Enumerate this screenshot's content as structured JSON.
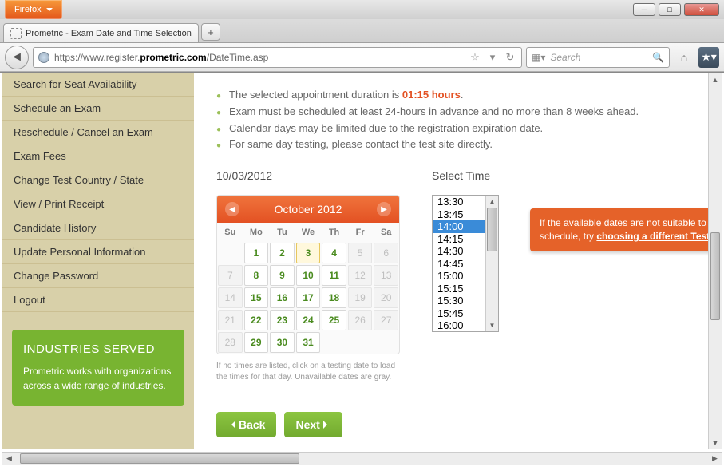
{
  "browser": {
    "name": "Firefox",
    "tab_title": "Prometric - Exam Date and Time Selection",
    "url_pre": "https://www.register.",
    "url_domain": "prometric.com",
    "url_post": "/DateTime.asp",
    "search_placeholder": "Search"
  },
  "sidebar": {
    "links": [
      "Search for Seat Availability",
      "Schedule an Exam",
      "Reschedule / Cancel an Exam",
      "Exam Fees",
      "Change Test Country / State",
      "View / Print Receipt",
      "Candidate History",
      "Update Personal Information",
      "Change Password",
      "Logout"
    ],
    "card_title": "Industries Served",
    "card_body": "Prometric works with organizations across a wide range of industries."
  },
  "bullets": {
    "b1_pre": "The selected appointment duration is ",
    "b1_hl": "01:15 hours",
    "b1_post": ".",
    "b2": "Exam must be scheduled at least 24-hours in advance and no more than 8 weeks ahead.",
    "b3": "Calendar days may be limited due to the registration expiration date.",
    "b4": "For same day testing, please contact the test site directly."
  },
  "date": {
    "selected": "10/03/2012",
    "month_label": "October 2012",
    "dow": [
      "Su",
      "Mo",
      "Tu",
      "We",
      "Th",
      "Fr",
      "Sa"
    ],
    "cells": [
      {
        "t": "",
        "c": "empty"
      },
      {
        "t": "1",
        "c": "avail"
      },
      {
        "t": "2",
        "c": "avail"
      },
      {
        "t": "3",
        "c": "avail selected"
      },
      {
        "t": "4",
        "c": "avail"
      },
      {
        "t": "5",
        "c": "disabled"
      },
      {
        "t": "6",
        "c": "disabled"
      },
      {
        "t": "7",
        "c": "disabled"
      },
      {
        "t": "8",
        "c": "avail"
      },
      {
        "t": "9",
        "c": "avail"
      },
      {
        "t": "10",
        "c": "avail"
      },
      {
        "t": "11",
        "c": "avail"
      },
      {
        "t": "12",
        "c": "disabled"
      },
      {
        "t": "13",
        "c": "disabled"
      },
      {
        "t": "14",
        "c": "disabled"
      },
      {
        "t": "15",
        "c": "avail"
      },
      {
        "t": "16",
        "c": "avail"
      },
      {
        "t": "17",
        "c": "avail"
      },
      {
        "t": "18",
        "c": "avail"
      },
      {
        "t": "19",
        "c": "disabled"
      },
      {
        "t": "20",
        "c": "disabled"
      },
      {
        "t": "21",
        "c": "disabled"
      },
      {
        "t": "22",
        "c": "avail"
      },
      {
        "t": "23",
        "c": "avail"
      },
      {
        "t": "24",
        "c": "avail"
      },
      {
        "t": "25",
        "c": "avail"
      },
      {
        "t": "26",
        "c": "disabled"
      },
      {
        "t": "27",
        "c": "disabled"
      },
      {
        "t": "28",
        "c": "disabled"
      },
      {
        "t": "29",
        "c": "avail"
      },
      {
        "t": "30",
        "c": "avail"
      },
      {
        "t": "31",
        "c": "avail"
      },
      {
        "t": "",
        "c": "empty"
      },
      {
        "t": "",
        "c": "empty"
      },
      {
        "t": "",
        "c": "empty"
      }
    ],
    "note": "If no times are listed, click on a testing date to load the times for that day. Unavailable dates are gray."
  },
  "time": {
    "label": "Select Time",
    "options": [
      "13:30",
      "13:45",
      "14:00",
      "14:15",
      "14:30",
      "14:45",
      "15:00",
      "15:15",
      "15:30",
      "15:45",
      "16:00"
    ],
    "selected": "14:00"
  },
  "flyout": {
    "text_pre": "If the available dates are not suitable to schedule, try ",
    "link": "choosing a different Test"
  },
  "buttons": {
    "back": "Back",
    "next": "Next"
  }
}
